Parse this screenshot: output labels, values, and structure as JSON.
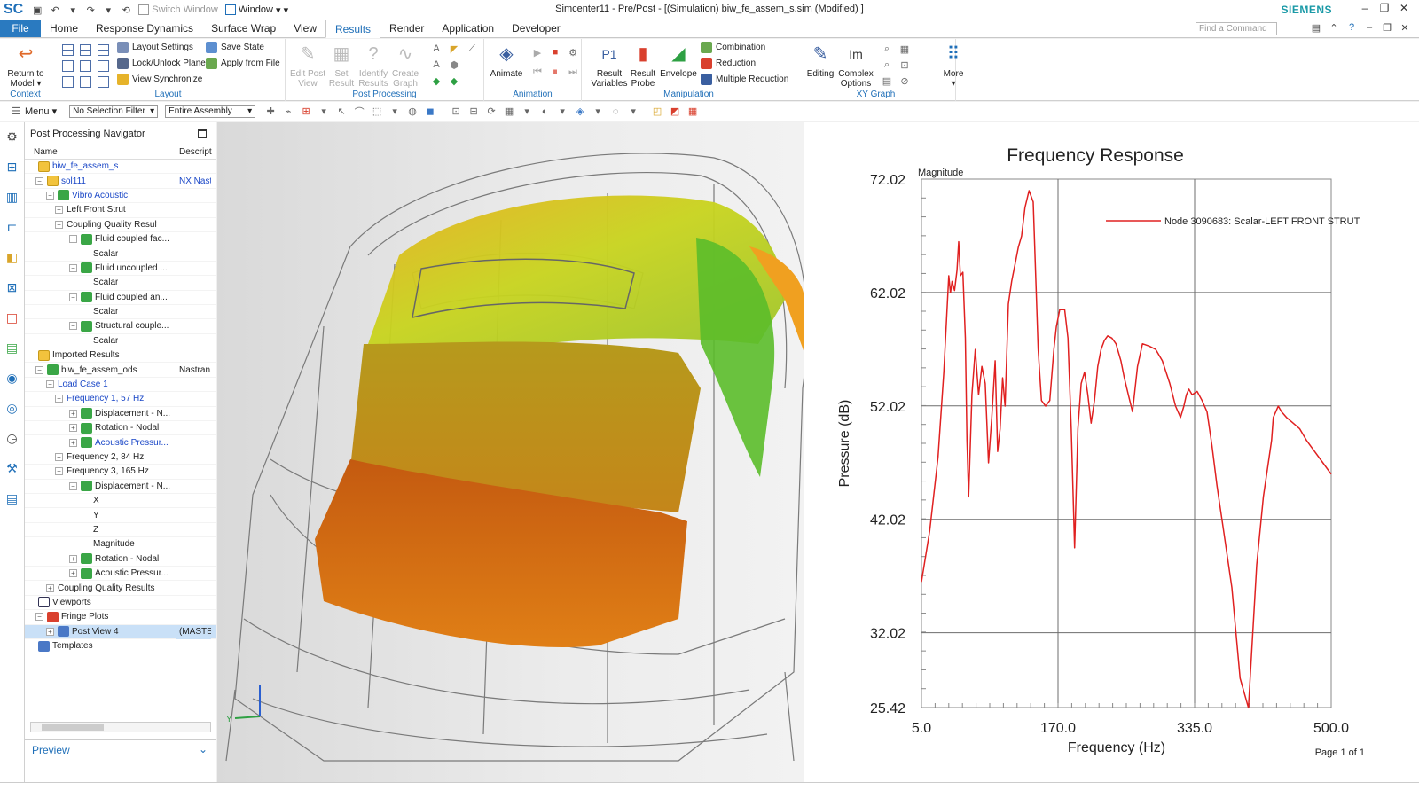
{
  "window": {
    "logo": "SC",
    "title": "Simcenter11 - Pre/Post - [(Simulation) biw_fe_assem_s.sim (Modified) ]",
    "brand": "SIEMENS",
    "switch_window": "Switch Window",
    "window_menu": "Window"
  },
  "tabs": [
    "File",
    "Home",
    "Response Dynamics",
    "Surface Wrap",
    "View",
    "Results",
    "Render",
    "Application",
    "Developer"
  ],
  "find_command_placeholder": "Find a Command",
  "ribbon": {
    "context": {
      "label": "Context",
      "return_to_model": "Return to Model"
    },
    "layout": {
      "label": "Layout",
      "layout_settings": "Layout Settings",
      "lock_unlock_plane": "Lock/Unlock Plane",
      "view_synchronize": "View Synchronize",
      "save_state": "Save State",
      "apply_from_file": "Apply from File"
    },
    "post_processing": {
      "label": "Post Processing",
      "edit_post_view": "Edit Post View",
      "set_result": "Set Result",
      "identify_results": "Identify Results",
      "create_graph": "Create Graph"
    },
    "animation": {
      "label": "Animation",
      "animate": "Animate"
    },
    "manipulation": {
      "label": "Manipulation",
      "result_variables": "Result Variables",
      "result_probe": "Result Probe",
      "envelope": "Envelope",
      "combination": "Combination",
      "reduction": "Reduction",
      "multiple_reduction": "Multiple Reduction"
    },
    "xy_graph": {
      "label": "XY Graph",
      "editing": "Editing",
      "complex_options": "Complex Options",
      "more": "More"
    }
  },
  "toolbar": {
    "menu": "Menu",
    "selection_filter": "No Selection Filter",
    "assembly_scope": "Entire Assembly"
  },
  "navigator": {
    "title": "Post Processing Navigator",
    "col_name": "Name",
    "col_desc": "Descript",
    "rows": [
      {
        "label": "biw_fe_assem_s",
        "desc": "",
        "blue": true
      },
      {
        "label": "sol111",
        "desc": "NX Nast",
        "blue": true
      },
      {
        "label": "Vibro Acoustic",
        "desc": "",
        "blue": true
      },
      {
        "label": "Left Front Strut",
        "desc": ""
      },
      {
        "label": "Coupling Quality Results",
        "desc": ""
      },
      {
        "label": "Fluid coupled fac...",
        "desc": ""
      },
      {
        "label": "Scalar",
        "desc": ""
      },
      {
        "label": "Fluid uncoupled ...",
        "desc": ""
      },
      {
        "label": "Scalar",
        "desc": ""
      },
      {
        "label": "Fluid coupled an...",
        "desc": ""
      },
      {
        "label": "Scalar",
        "desc": ""
      },
      {
        "label": "Structural couple...",
        "desc": ""
      },
      {
        "label": "Scalar",
        "desc": ""
      },
      {
        "label": "Imported Results",
        "desc": ""
      },
      {
        "label": "biw_fe_assem_ods",
        "desc": "Nastran,"
      },
      {
        "label": "Load Case 1",
        "desc": "",
        "blue": true
      },
      {
        "label": "Frequency 1, 57 Hz",
        "desc": "",
        "blue": true
      },
      {
        "label": "Displacement - N...",
        "desc": ""
      },
      {
        "label": "Rotation - Nodal",
        "desc": ""
      },
      {
        "label": "Acoustic Pressur...",
        "desc": "",
        "blue": true
      },
      {
        "label": "Frequency 2, 84 Hz",
        "desc": ""
      },
      {
        "label": "Frequency 3, 165 Hz",
        "desc": ""
      },
      {
        "label": "Displacement - N...",
        "desc": ""
      },
      {
        "label": "X",
        "desc": ""
      },
      {
        "label": "Y",
        "desc": ""
      },
      {
        "label": "Z",
        "desc": ""
      },
      {
        "label": "Magnitude",
        "desc": ""
      },
      {
        "label": "Rotation - Nodal",
        "desc": ""
      },
      {
        "label": "Acoustic Pressur...",
        "desc": ""
      },
      {
        "label": "Coupling Quality Results",
        "desc": ""
      },
      {
        "label": "Viewports",
        "desc": ""
      },
      {
        "label": "Fringe Plots",
        "desc": ""
      },
      {
        "label": "Post View 4",
        "desc": "(MASTE",
        "selected": true
      },
      {
        "label": "Templates",
        "desc": ""
      }
    ],
    "preview": "Preview"
  },
  "viewport": {
    "triad_label": "Y"
  },
  "chart_data": {
    "type": "line",
    "title": "Frequency Response",
    "xlabel": "Frequency (Hz)",
    "ylabel": "Pressure (dB)",
    "y_unit_label": "Magnitude",
    "xlim": [
      5.0,
      500.0
    ],
    "ylim": [
      25.42,
      72.02
    ],
    "x_ticks": [
      "5.0",
      "170.0",
      "335.0",
      "500.0"
    ],
    "y_ticks": [
      "72.02",
      "62.02",
      "52.02",
      "42.02",
      "32.02",
      "25.42"
    ],
    "grid": true,
    "legend_position": "top-right",
    "page_label": "Page 1 of 1",
    "color": "#e02020",
    "series": [
      {
        "name": "Node 3090683: Scalar-LEFT FRONT STRUT",
        "x": [
          5,
          15,
          25,
          32,
          38,
          40,
          42,
          45,
          48,
          50,
          52,
          55,
          58,
          60,
          62,
          66,
          70,
          74,
          78,
          82,
          86,
          90,
          94,
          97,
          100,
          103,
          106,
          110,
          114,
          118,
          122,
          126,
          130,
          135,
          140,
          146,
          150,
          155,
          160,
          165,
          168,
          172,
          175,
          178,
          182,
          186,
          190,
          194,
          198,
          202,
          206,
          210,
          214,
          218,
          222,
          226,
          230,
          235,
          240,
          246,
          250,
          255,
          260,
          266,
          272,
          280,
          288,
          296,
          305,
          312,
          318,
          322,
          325,
          328,
          332,
          338,
          344,
          350,
          356,
          362,
          370,
          380,
          390,
          400,
          410,
          418,
          424,
          428,
          430,
          433,
          436,
          440,
          446,
          454,
          462,
          470,
          480,
          490,
          500
        ],
        "y": [
          36.5,
          41.0,
          47.5,
          55.0,
          63.5,
          62.0,
          63.0,
          62.2,
          64.0,
          66.5,
          63.5,
          63.8,
          58.0,
          49.0,
          44.0,
          53.0,
          57.0,
          53.0,
          55.5,
          54.0,
          47.0,
          51.0,
          56.0,
          48.0,
          50.0,
          54.5,
          52.0,
          61.0,
          63.0,
          64.5,
          66.0,
          67.0,
          69.5,
          71.0,
          70.0,
          57.0,
          52.5,
          52.0,
          52.5,
          57.0,
          59.0,
          60.5,
          60.5,
          60.5,
          58.0,
          50.0,
          39.5,
          50.0,
          54.0,
          55.0,
          53.0,
          50.5,
          52.5,
          55.5,
          57.0,
          57.8,
          58.2,
          58.0,
          57.5,
          56.0,
          54.5,
          53.0,
          51.5,
          55.5,
          57.5,
          57.3,
          57.0,
          56.0,
          54.0,
          52.0,
          51.0,
          52.0,
          53.0,
          53.5,
          53.0,
          53.3,
          52.5,
          51.5,
          48.5,
          45.0,
          41.0,
          36.0,
          28.0,
          25.4,
          38.0,
          44.0,
          47.0,
          49.0,
          51.0,
          51.5,
          52.0,
          51.5,
          51.0,
          50.5,
          50.0,
          49.0,
          48.0,
          47.0,
          46.0
        ]
      }
    ]
  }
}
